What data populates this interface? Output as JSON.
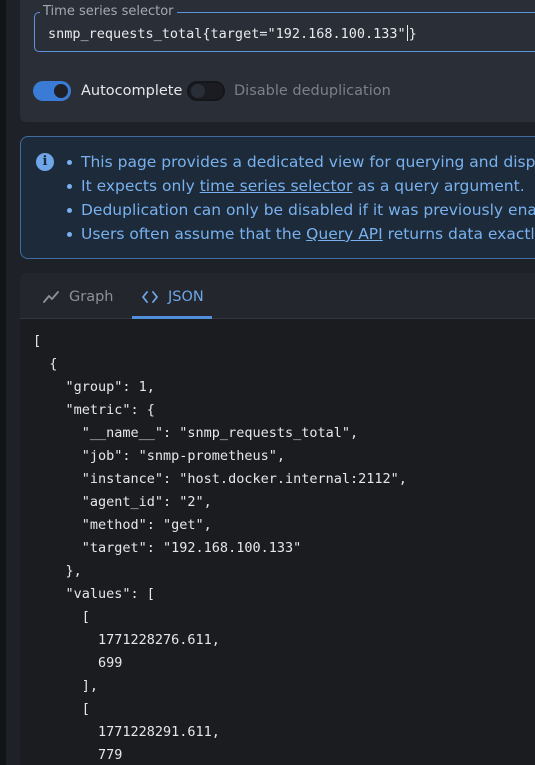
{
  "selector": {
    "legend": "Time series selector",
    "value_before_caret": "snmp_requests_total{target=\"192.168.100.133\"",
    "value_after_caret": "}"
  },
  "toggles": {
    "autocomplete_label": "Autocomplete",
    "autocomplete_on": true,
    "dedup_label": "Disable deduplication",
    "dedup_on": false
  },
  "info": {
    "icon": "info-circle-icon",
    "line1": "This page provides a dedicated view for querying and displa",
    "line2_before": "It expects only ",
    "line2_link": "time series selector",
    "line2_after": " as a query argument.",
    "line3": "Deduplication can only be disabled if it was previously enab",
    "line4_before": "Users often assume that the ",
    "line4_link": "Query API",
    "line4_after": " returns data exactly a"
  },
  "tabs": {
    "graph_label": "Graph",
    "json_label": "JSON",
    "active": "JSON"
  },
  "json_output": "[\n  {\n    \"group\": 1,\n    \"metric\": {\n      \"__name__\": \"snmp_requests_total\",\n      \"job\": \"snmp-prometheus\",\n      \"instance\": \"host.docker.internal:2112\",\n      \"agent_id\": \"2\",\n      \"method\": \"get\",\n      \"target\": \"192.168.100.133\"\n    },\n    \"values\": [\n      [\n        1771228276.611,\n        699\n      ],\n      [\n        1771228291.611,\n        779",
  "colors": {
    "accent": "#3a7bd5",
    "info_text": "#79b1ee",
    "background": "#1e2128"
  }
}
